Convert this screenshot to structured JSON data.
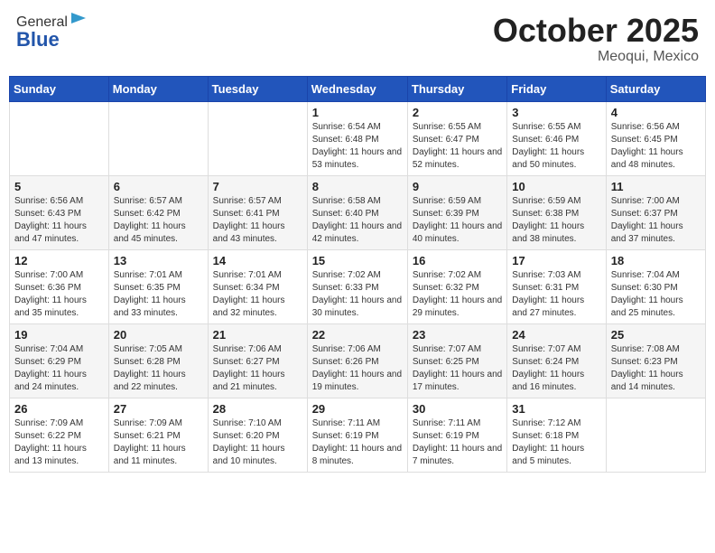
{
  "logo": {
    "general": "General",
    "blue": "Blue"
  },
  "title": "October 2025",
  "subtitle": "Meoqui, Mexico",
  "days_header": [
    "Sunday",
    "Monday",
    "Tuesday",
    "Wednesday",
    "Thursday",
    "Friday",
    "Saturday"
  ],
  "weeks": [
    [
      {
        "day": "",
        "info": ""
      },
      {
        "day": "",
        "info": ""
      },
      {
        "day": "",
        "info": ""
      },
      {
        "day": "1",
        "sunrise": "6:54 AM",
        "sunset": "6:48 PM",
        "daylight": "11 hours and 53 minutes."
      },
      {
        "day": "2",
        "sunrise": "6:55 AM",
        "sunset": "6:47 PM",
        "daylight": "11 hours and 52 minutes."
      },
      {
        "day": "3",
        "sunrise": "6:55 AM",
        "sunset": "6:46 PM",
        "daylight": "11 hours and 50 minutes."
      },
      {
        "day": "4",
        "sunrise": "6:56 AM",
        "sunset": "6:45 PM",
        "daylight": "11 hours and 48 minutes."
      }
    ],
    [
      {
        "day": "5",
        "sunrise": "6:56 AM",
        "sunset": "6:43 PM",
        "daylight": "11 hours and 47 minutes."
      },
      {
        "day": "6",
        "sunrise": "6:57 AM",
        "sunset": "6:42 PM",
        "daylight": "11 hours and 45 minutes."
      },
      {
        "day": "7",
        "sunrise": "6:57 AM",
        "sunset": "6:41 PM",
        "daylight": "11 hours and 43 minutes."
      },
      {
        "day": "8",
        "sunrise": "6:58 AM",
        "sunset": "6:40 PM",
        "daylight": "11 hours and 42 minutes."
      },
      {
        "day": "9",
        "sunrise": "6:59 AM",
        "sunset": "6:39 PM",
        "daylight": "11 hours and 40 minutes."
      },
      {
        "day": "10",
        "sunrise": "6:59 AM",
        "sunset": "6:38 PM",
        "daylight": "11 hours and 38 minutes."
      },
      {
        "day": "11",
        "sunrise": "7:00 AM",
        "sunset": "6:37 PM",
        "daylight": "11 hours and 37 minutes."
      }
    ],
    [
      {
        "day": "12",
        "sunrise": "7:00 AM",
        "sunset": "6:36 PM",
        "daylight": "11 hours and 35 minutes."
      },
      {
        "day": "13",
        "sunrise": "7:01 AM",
        "sunset": "6:35 PM",
        "daylight": "11 hours and 33 minutes."
      },
      {
        "day": "14",
        "sunrise": "7:01 AM",
        "sunset": "6:34 PM",
        "daylight": "11 hours and 32 minutes."
      },
      {
        "day": "15",
        "sunrise": "7:02 AM",
        "sunset": "6:33 PM",
        "daylight": "11 hours and 30 minutes."
      },
      {
        "day": "16",
        "sunrise": "7:02 AM",
        "sunset": "6:32 PM",
        "daylight": "11 hours and 29 minutes."
      },
      {
        "day": "17",
        "sunrise": "7:03 AM",
        "sunset": "6:31 PM",
        "daylight": "11 hours and 27 minutes."
      },
      {
        "day": "18",
        "sunrise": "7:04 AM",
        "sunset": "6:30 PM",
        "daylight": "11 hours and 25 minutes."
      }
    ],
    [
      {
        "day": "19",
        "sunrise": "7:04 AM",
        "sunset": "6:29 PM",
        "daylight": "11 hours and 24 minutes."
      },
      {
        "day": "20",
        "sunrise": "7:05 AM",
        "sunset": "6:28 PM",
        "daylight": "11 hours and 22 minutes."
      },
      {
        "day": "21",
        "sunrise": "7:06 AM",
        "sunset": "6:27 PM",
        "daylight": "11 hours and 21 minutes."
      },
      {
        "day": "22",
        "sunrise": "7:06 AM",
        "sunset": "6:26 PM",
        "daylight": "11 hours and 19 minutes."
      },
      {
        "day": "23",
        "sunrise": "7:07 AM",
        "sunset": "6:25 PM",
        "daylight": "11 hours and 17 minutes."
      },
      {
        "day": "24",
        "sunrise": "7:07 AM",
        "sunset": "6:24 PM",
        "daylight": "11 hours and 16 minutes."
      },
      {
        "day": "25",
        "sunrise": "7:08 AM",
        "sunset": "6:23 PM",
        "daylight": "11 hours and 14 minutes."
      }
    ],
    [
      {
        "day": "26",
        "sunrise": "7:09 AM",
        "sunset": "6:22 PM",
        "daylight": "11 hours and 13 minutes."
      },
      {
        "day": "27",
        "sunrise": "7:09 AM",
        "sunset": "6:21 PM",
        "daylight": "11 hours and 11 minutes."
      },
      {
        "day": "28",
        "sunrise": "7:10 AM",
        "sunset": "6:20 PM",
        "daylight": "11 hours and 10 minutes."
      },
      {
        "day": "29",
        "sunrise": "7:11 AM",
        "sunset": "6:19 PM",
        "daylight": "11 hours and 8 minutes."
      },
      {
        "day": "30",
        "sunrise": "7:11 AM",
        "sunset": "6:19 PM",
        "daylight": "11 hours and 7 minutes."
      },
      {
        "day": "31",
        "sunrise": "7:12 AM",
        "sunset": "6:18 PM",
        "daylight": "11 hours and 5 minutes."
      },
      {
        "day": "",
        "info": ""
      }
    ]
  ]
}
